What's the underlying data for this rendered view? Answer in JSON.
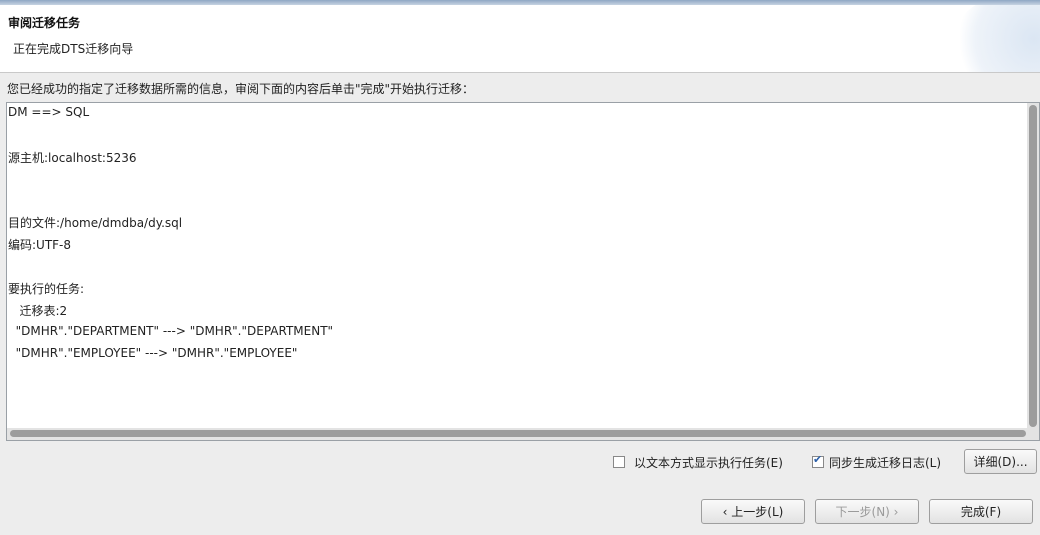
{
  "header": {
    "title": "审阅迁移任务",
    "subtitle": "正在完成DTS迁移向导"
  },
  "intro": "您已经成功的指定了迁移数据所需的信息，审阅下面的内容后单击\"完成\"开始执行迁移：",
  "summary": {
    "lines": [
      "DM ==> SQL",
      "源主机:localhost:5236",
      "目的文件:/home/dmdba/dy.sql",
      "编码:UTF-8",
      "要执行的任务:",
      "   迁移表:2",
      "  \"DMHR\".\"DEPARTMENT\" ---> \"DMHR\".\"DEPARTMENT\"",
      "  \"DMHR\".\"EMPLOYEE\" ---> \"DMHR\".\"EMPLOYEE\""
    ]
  },
  "options": {
    "show_as_text": {
      "label": "以文本方式显示执行任务(E)",
      "checked": false
    },
    "sync_log": {
      "label": "同步生成迁移日志(L)",
      "checked": true
    },
    "details_button": "详细(D)..."
  },
  "nav": {
    "back": "上一步(L)",
    "next": "下一步(N)",
    "finish": "完成(F)"
  }
}
